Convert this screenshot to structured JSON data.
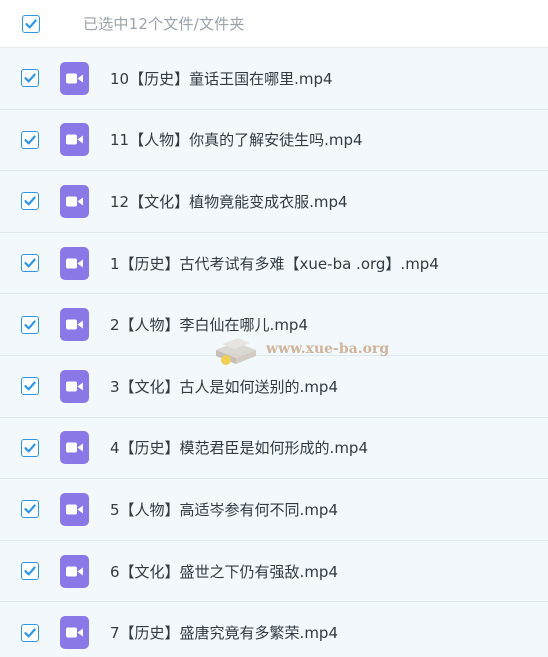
{
  "header": {
    "select_all_checked": true,
    "selection_text": "已选中12个文件/文件夹"
  },
  "files": [
    {
      "name": "10【历史】童话王国在哪里.mp4",
      "checked": true,
      "icon": "video-icon"
    },
    {
      "name": "11【人物】你真的了解安徒生吗.mp4",
      "checked": true,
      "icon": "video-icon"
    },
    {
      "name": "12【文化】植物竟能变成衣服.mp4",
      "checked": true,
      "icon": "video-icon"
    },
    {
      "name": "1【历史】古代考试有多难【xue-ba .org】.mp4",
      "checked": true,
      "icon": "video-icon"
    },
    {
      "name": "2【人物】李白仙在哪儿.mp4",
      "checked": true,
      "icon": "video-icon"
    },
    {
      "name": "3【文化】古人是如何送别的.mp4",
      "checked": true,
      "icon": "video-icon"
    },
    {
      "name": "4【历史】模范君臣是如何形成的.mp4",
      "checked": true,
      "icon": "video-icon"
    },
    {
      "name": "5【人物】高适岑参有何不同.mp4",
      "checked": true,
      "icon": "video-icon"
    },
    {
      "name": "6【文化】盛世之下仍有强敌.mp4",
      "checked": true,
      "icon": "video-icon"
    },
    {
      "name": "7【历史】盛唐究竟有多繁荣.mp4",
      "checked": true,
      "icon": "video-icon"
    }
  ],
  "watermark": {
    "text": "www.xue-ba.org"
  },
  "colors": {
    "accent": "#2d96e6",
    "video_icon": "#8a78e6",
    "row_bg": "#f2f8fc",
    "header_text": "#9aa3ab",
    "file_text": "#333a40"
  }
}
